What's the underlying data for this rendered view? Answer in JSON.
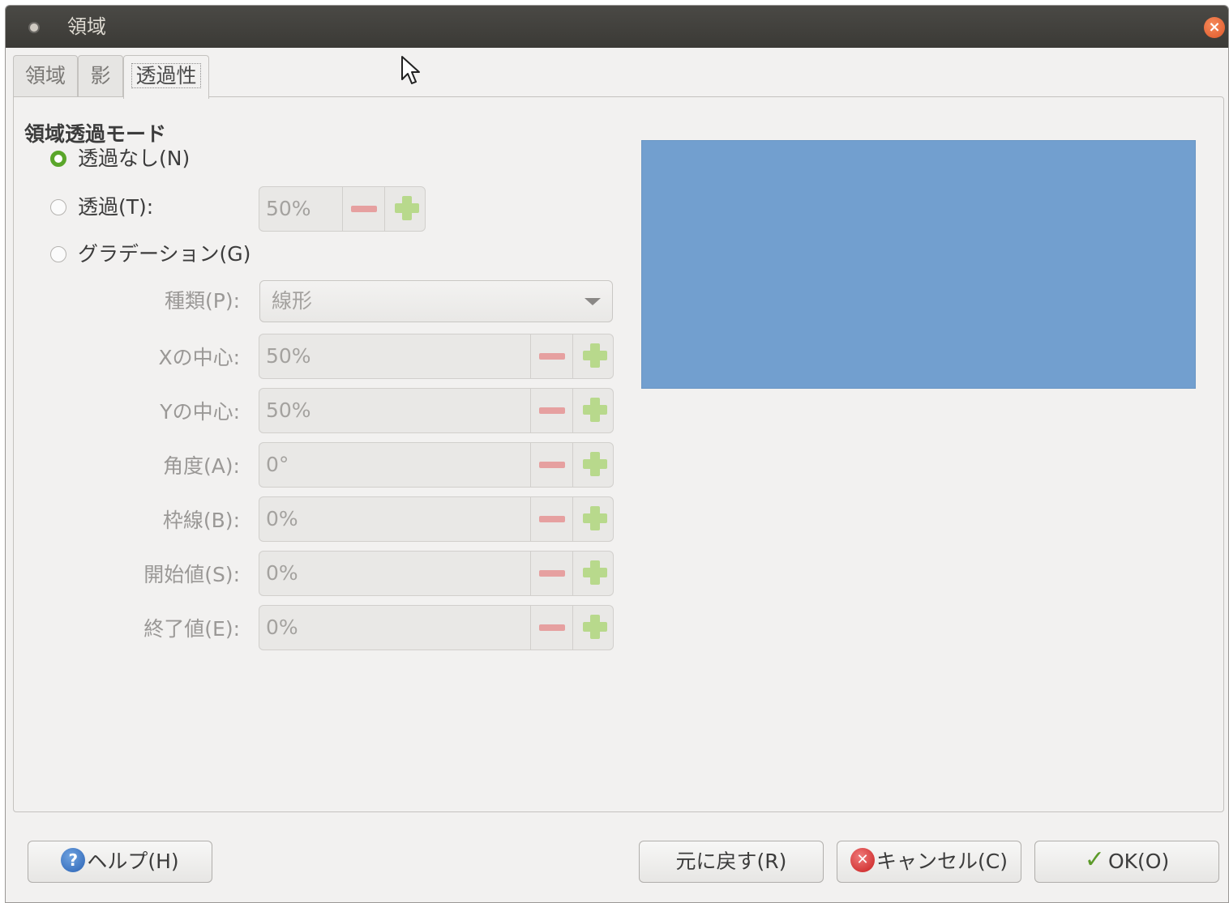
{
  "window": {
    "title": "領域"
  },
  "tabs": [
    {
      "label": "領域",
      "active": false
    },
    {
      "label": "影",
      "active": false
    },
    {
      "label": "透過性",
      "active": true
    }
  ],
  "section": {
    "title": "領域透過モード"
  },
  "modes": {
    "none": {
      "label": "透過なし(N)",
      "checked": true
    },
    "transparency": {
      "label": "透過(T):",
      "checked": false,
      "value": "50%"
    },
    "gradient": {
      "label": "グラデーション(G)",
      "checked": false
    }
  },
  "gradient": {
    "type": {
      "label": "種類(P):",
      "value": "線形"
    },
    "fields": [
      {
        "label": "Xの中心:",
        "value": "50%"
      },
      {
        "label": "Yの中心:",
        "value": "50%"
      },
      {
        "label": "角度(A):",
        "value": "0°"
      },
      {
        "label": "枠線(B):",
        "value": "0%"
      },
      {
        "label": "開始値(S):",
        "value": "0%"
      },
      {
        "label": "終了値(E):",
        "value": "0%"
      }
    ]
  },
  "preview": {
    "color": "#729fcf"
  },
  "buttons": {
    "help": "ヘルプ(H)",
    "reset": "元に戻す(R)",
    "cancel": "キャンセル(C)",
    "ok": "OK(O)"
  }
}
